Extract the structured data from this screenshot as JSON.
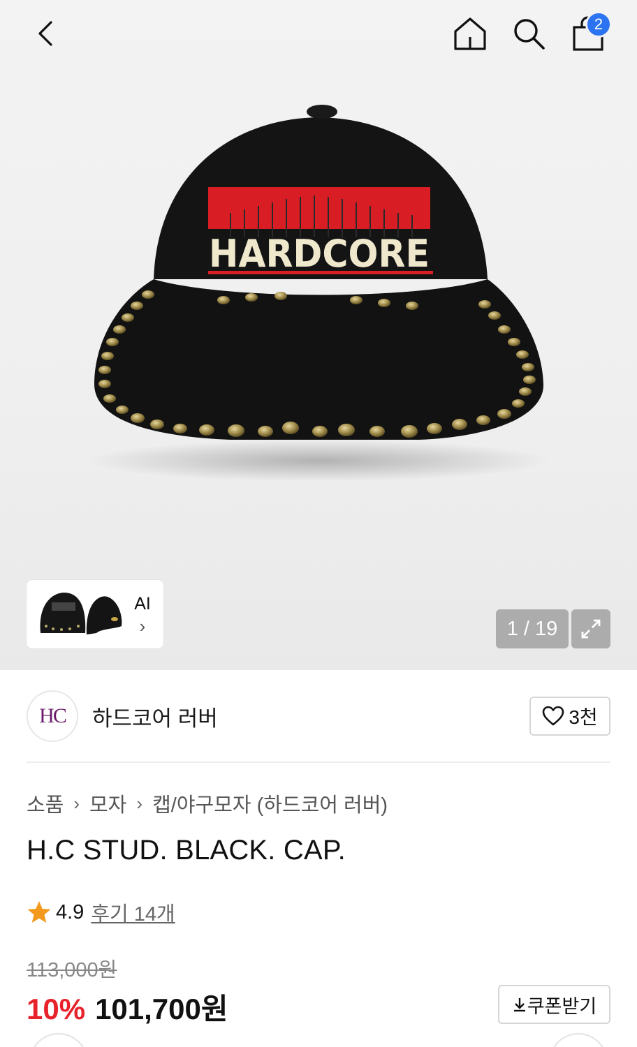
{
  "header": {
    "cart_count": "2"
  },
  "gallery": {
    "counter": "1 / 19",
    "thumb_label": "AI",
    "thumb_chevron": "›",
    "cap_text": "HARDCORE"
  },
  "store": {
    "logo_text": "HC",
    "name": "하드코어 러버",
    "likes": "3천"
  },
  "breadcrumb": [
    "소품",
    "모자",
    "캡/야구모자 (하드코어 러버)"
  ],
  "product": {
    "title": "H.C STUD. BLACK. CAP.",
    "rating": "4.9",
    "reviews": "후기 14개",
    "original_price": "113,000원",
    "discount": "10%",
    "final_price": "101,700원",
    "coupon_label": "쿠폰받기"
  },
  "colors": {
    "discount_red": "#e8222b",
    "badge_blue": "#2b73f0",
    "star": "#f39a1e"
  }
}
